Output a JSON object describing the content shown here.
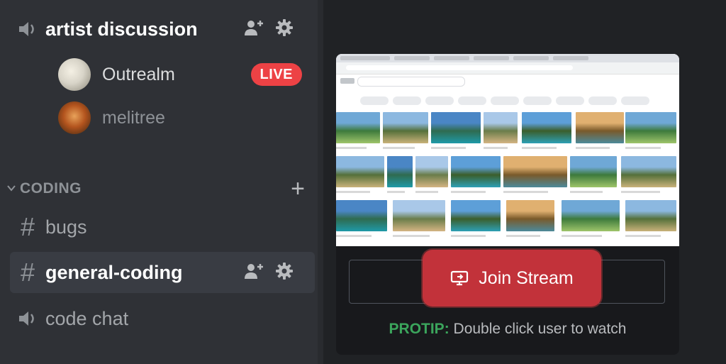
{
  "sidebar": {
    "voice_channel_top": {
      "name": "artist discussion",
      "icon": "speaker-icon"
    },
    "voice_users": [
      {
        "name": "Outrealm",
        "badge": "LIVE",
        "avatar_color": "#d8d4c8"
      },
      {
        "name": "melitree",
        "avatar_color": "#b3541e"
      }
    ],
    "category": {
      "name": "CODING",
      "icon": "chevron-down-icon",
      "add_icon": "plus-icon"
    },
    "channels": [
      {
        "name": "bugs",
        "type": "text"
      },
      {
        "name": "general-coding",
        "type": "text",
        "selected": true
      },
      {
        "name": "code chat",
        "type": "voice"
      }
    ]
  },
  "stream": {
    "join_label": "Join Stream",
    "join_icon": "screen-share-icon",
    "protip_tag": "PROTIP:",
    "protip_text": "Double click user to watch"
  },
  "colors": {
    "live": "#ed4245",
    "join": "#c2323a",
    "protip": "#3ba55c",
    "sidebar_bg": "#2f3136",
    "main_bg": "#202225"
  }
}
